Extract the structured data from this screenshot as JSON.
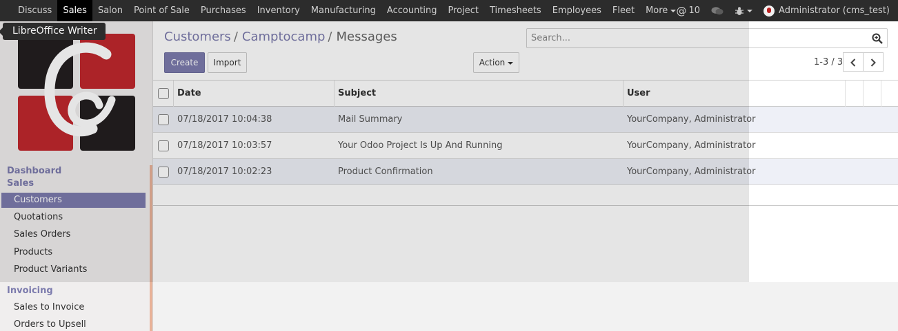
{
  "topbar": {
    "menu": [
      "Discuss",
      "Sales",
      "Salon",
      "Point of Sale",
      "Purchases",
      "Inventory",
      "Manufacturing",
      "Accounting",
      "Project",
      "Timesheets",
      "Employees",
      "Fleet"
    ],
    "active": "Sales",
    "more_label": "More",
    "mentions_count": "10",
    "user_label": "Administrator (cms_test)"
  },
  "tooltip": {
    "text": "LibreOffice Writer"
  },
  "sidebar": {
    "sections": [
      {
        "title": "Dashboard"
      },
      {
        "title": "Sales",
        "items": [
          "Customers",
          "Quotations",
          "Sales Orders",
          "Products",
          "Product Variants"
        ]
      },
      {
        "title": "Invoicing",
        "items": [
          "Sales to Invoice",
          "Orders to Upsell"
        ]
      }
    ],
    "active_item": "Customers"
  },
  "breadcrumb": {
    "items": [
      "Customers",
      "Camptocamp"
    ],
    "current": "Messages"
  },
  "search": {
    "placeholder": "Search..."
  },
  "buttons": {
    "create": "Create",
    "import": "Import",
    "action": "Action"
  },
  "pager": {
    "text": "1-3 / 3"
  },
  "table": {
    "columns": [
      "Date",
      "Subject",
      "User"
    ],
    "rows": [
      {
        "date": "07/18/2017 10:04:38",
        "subject": "Mail Summary",
        "user": "YourCompany, Administrator"
      },
      {
        "date": "07/18/2017 10:03:57",
        "subject": "Your Odoo Project Is Up And Running",
        "user": "YourCompany, Administrator"
      },
      {
        "date": "07/18/2017 10:02:23",
        "subject": "Product Confirmation",
        "user": "YourCompany, Administrator"
      }
    ]
  },
  "colors": {
    "accent": "#7c7bad",
    "topbar": "#2c2c2c",
    "logo_red": "#c0272d",
    "logo_dark": "#231f20"
  }
}
